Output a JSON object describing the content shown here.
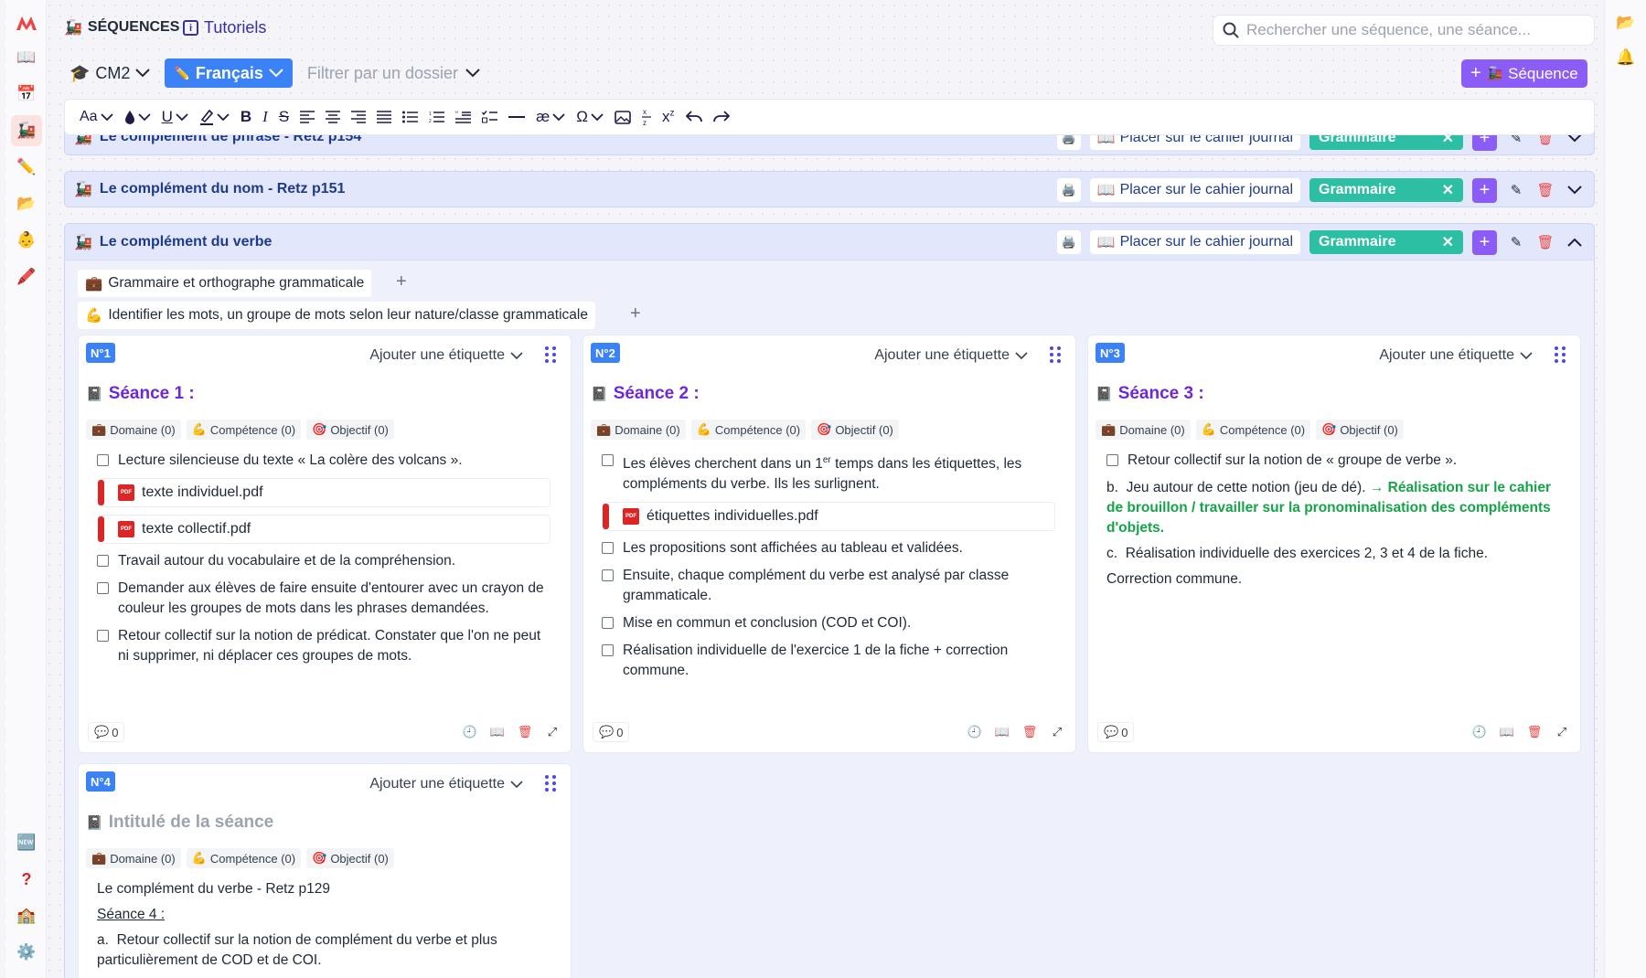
{
  "header": {
    "title": "SÉQUENCES",
    "tutorials": "Tutoriels",
    "search_placeholder": "Rechercher une séquence, une séance..."
  },
  "filters": {
    "level": "CM2",
    "subject": "Français",
    "folder_placeholder": "Filtrer par un dossier",
    "new_sequence": "Séquence"
  },
  "toolbar": {
    "font_size": "Aa"
  },
  "sequences": [
    {
      "name": "Le complément de phrase - Retz p154",
      "place": "Placer sur le cahier journal",
      "tag": "Grammaire"
    },
    {
      "name": "Le complément du nom - Retz p151",
      "place": "Placer sur le cahier journal",
      "tag": "Grammaire"
    },
    {
      "name": "Le complément du verbe",
      "place": "Placer sur le cahier journal",
      "tag": "Grammaire"
    }
  ],
  "expanded": {
    "domain": "Grammaire et orthographe grammaticale",
    "competence": "Identifier les mots, un groupe de mots selon leur nature/classe grammaticale"
  },
  "card_common": {
    "add_tag": "Ajouter une étiquette",
    "domaine": "Domaine (0)",
    "competence": "Compétence (0)",
    "objectif": "Objectif (0)",
    "comments": "0"
  },
  "cards": {
    "c1": {
      "num": "N°1",
      "title": "Séance 1 :",
      "t1": "Lecture silencieuse du texte « La colère des volcans ».",
      "pdf1": "texte individuel.pdf",
      "pdf2": "texte collectif.pdf",
      "t2": "Travail autour du vocabulaire et de la compréhension.",
      "t3": "Demander aux élèves de faire ensuite d'entourer avec un crayon de couleur les groupes de mots dans les phrases demandées.",
      "t4": "Retour collectif sur la notion de prédicat. Constater que l'on ne peut ni supprimer, ni déplacer ces groupes de mots."
    },
    "c2": {
      "num": "N°2",
      "title": "Séance 2 :",
      "t1a": "Les élèves cherchent dans un 1",
      "t1sup": "er",
      "t1b": " temps dans les étiquettes, les compléments du verbe. Ils les surlignent.",
      "pdf1": "étiquettes individuelles.pdf",
      "t2": "Les propositions sont affichées au tableau et validées.",
      "t3": "Ensuite, chaque complément du verbe est analysé par classe grammaticale.",
      "t4": "Mise en commun et conclusion (COD et COI).",
      "t5": "Réalisation individuelle de l'exercice 1 de la fiche + correction commune."
    },
    "c3": {
      "num": "N°3",
      "title": "Séance 3 :",
      "t1": "Retour collectif sur la notion de « groupe de verbe ».",
      "b_prefix": "b.",
      "b_text": "Jeu autour de cette notion (jeu de dé).",
      "b_green": "→ Réalisation sur le cahier de brouillon / travailler sur la pronominalisation des compléments d'objets.",
      "c_prefix": "c.",
      "c_text": "Réalisation individuelle des exercices 2, 3 et 4 de la fiche.",
      "d_text": "Correction commune."
    },
    "c4": {
      "num": "N°4",
      "title": "Intitulé de la séance",
      "l1": "Le complément du verbe - Retz p129",
      "l2": "Séance 4 :",
      "a_prefix": "a.",
      "a_text": "Retour collectif sur la notion de complément du verbe et plus particulièrement de COD et de COI."
    }
  }
}
